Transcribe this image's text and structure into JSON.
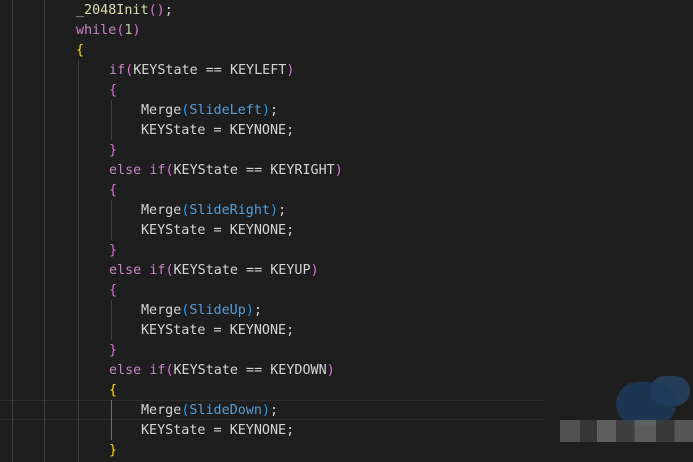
{
  "colors": {
    "background": "#1e1e1e",
    "default": "#d4d4d4",
    "function": "#dcdcaa",
    "keyword": "#c586c0",
    "number": "#b5cea8",
    "macro": "#569cd6",
    "variable": "#9cdcfe",
    "bracket1": "#ffd700",
    "bracket2": "#da70d6",
    "bracket3": "#179fff"
  },
  "code_lines": [
    [
      [
        "_2048Init",
        "function"
      ],
      [
        "(",
        "bracket2"
      ],
      [
        ")",
        "bracket2"
      ],
      [
        ";",
        "default"
      ]
    ],
    [
      [
        "while",
        "keyword"
      ],
      [
        "(",
        "bracket2"
      ],
      [
        "1",
        "number"
      ],
      [
        ")",
        "bracket2"
      ]
    ],
    [
      [
        "{",
        "bracket1"
      ]
    ],
    [
      [
        "if",
        "keyword"
      ],
      [
        "(",
        "bracket2"
      ],
      [
        "KEYState",
        "default"
      ],
      [
        " == ",
        "default"
      ],
      [
        "KEYLEFT",
        "default"
      ],
      [
        ")",
        "bracket2"
      ]
    ],
    [
      [
        "{",
        "bracket2"
      ]
    ],
    [
      [
        "Merge",
        "default"
      ],
      [
        "(",
        "bracket3"
      ],
      [
        "SlideLeft",
        "macro"
      ],
      [
        ")",
        "bracket3"
      ],
      [
        ";",
        "default"
      ]
    ],
    [
      [
        "KEYState",
        "default"
      ],
      [
        " = ",
        "default"
      ],
      [
        "KEYNONE",
        "default"
      ],
      [
        ";",
        "default"
      ]
    ],
    [
      [
        "}",
        "bracket2"
      ]
    ],
    [
      [
        "else",
        "keyword"
      ],
      [
        " ",
        "default"
      ],
      [
        "if",
        "keyword"
      ],
      [
        "(",
        "bracket2"
      ],
      [
        "KEYState",
        "default"
      ],
      [
        " == ",
        "default"
      ],
      [
        "KEYRIGHT",
        "default"
      ],
      [
        ")",
        "bracket2"
      ]
    ],
    [
      [
        "{",
        "bracket2"
      ]
    ],
    [
      [
        "Merge",
        "default"
      ],
      [
        "(",
        "bracket3"
      ],
      [
        "SlideRight",
        "macro"
      ],
      [
        ")",
        "bracket3"
      ],
      [
        ";",
        "default"
      ]
    ],
    [
      [
        "KEYState",
        "default"
      ],
      [
        " = ",
        "default"
      ],
      [
        "KEYNONE",
        "default"
      ],
      [
        ";",
        "default"
      ]
    ],
    [
      [
        "}",
        "bracket2"
      ]
    ],
    [
      [
        "else",
        "keyword"
      ],
      [
        " ",
        "default"
      ],
      [
        "if",
        "keyword"
      ],
      [
        "(",
        "bracket2"
      ],
      [
        "KEYState",
        "default"
      ],
      [
        " == ",
        "default"
      ],
      [
        "KEYUP",
        "default"
      ],
      [
        ")",
        "bracket2"
      ]
    ],
    [
      [
        "{",
        "bracket2"
      ]
    ],
    [
      [
        "Merge",
        "default"
      ],
      [
        "(",
        "bracket3"
      ],
      [
        "SlideUp",
        "macro"
      ],
      [
        ")",
        "bracket3"
      ],
      [
        ";",
        "default"
      ]
    ],
    [
      [
        "KEYState",
        "default"
      ],
      [
        " = ",
        "default"
      ],
      [
        "KEYNONE",
        "default"
      ],
      [
        ";",
        "default"
      ]
    ],
    [
      [
        "}",
        "bracket2"
      ]
    ],
    [
      [
        "else",
        "keyword"
      ],
      [
        " ",
        "default"
      ],
      [
        "if",
        "keyword"
      ],
      [
        "(",
        "bracket2"
      ],
      [
        "KEYState",
        "default"
      ],
      [
        " == ",
        "default"
      ],
      [
        "KEYDOWN",
        "default"
      ],
      [
        ")",
        "bracket2"
      ]
    ],
    [
      [
        "{",
        "bracket1"
      ]
    ],
    [
      [
        "Merge",
        "default"
      ],
      [
        "(",
        "bracket3"
      ],
      [
        "SlideDown",
        "macro"
      ],
      [
        ")",
        "bracket3"
      ],
      [
        ";",
        "default"
      ]
    ],
    [
      [
        "KEYState",
        "default"
      ],
      [
        " = ",
        "default"
      ],
      [
        "KEYNONE",
        "default"
      ],
      [
        ";",
        "default"
      ]
    ],
    [
      [
        "}",
        "bracket1"
      ]
    ]
  ]
}
